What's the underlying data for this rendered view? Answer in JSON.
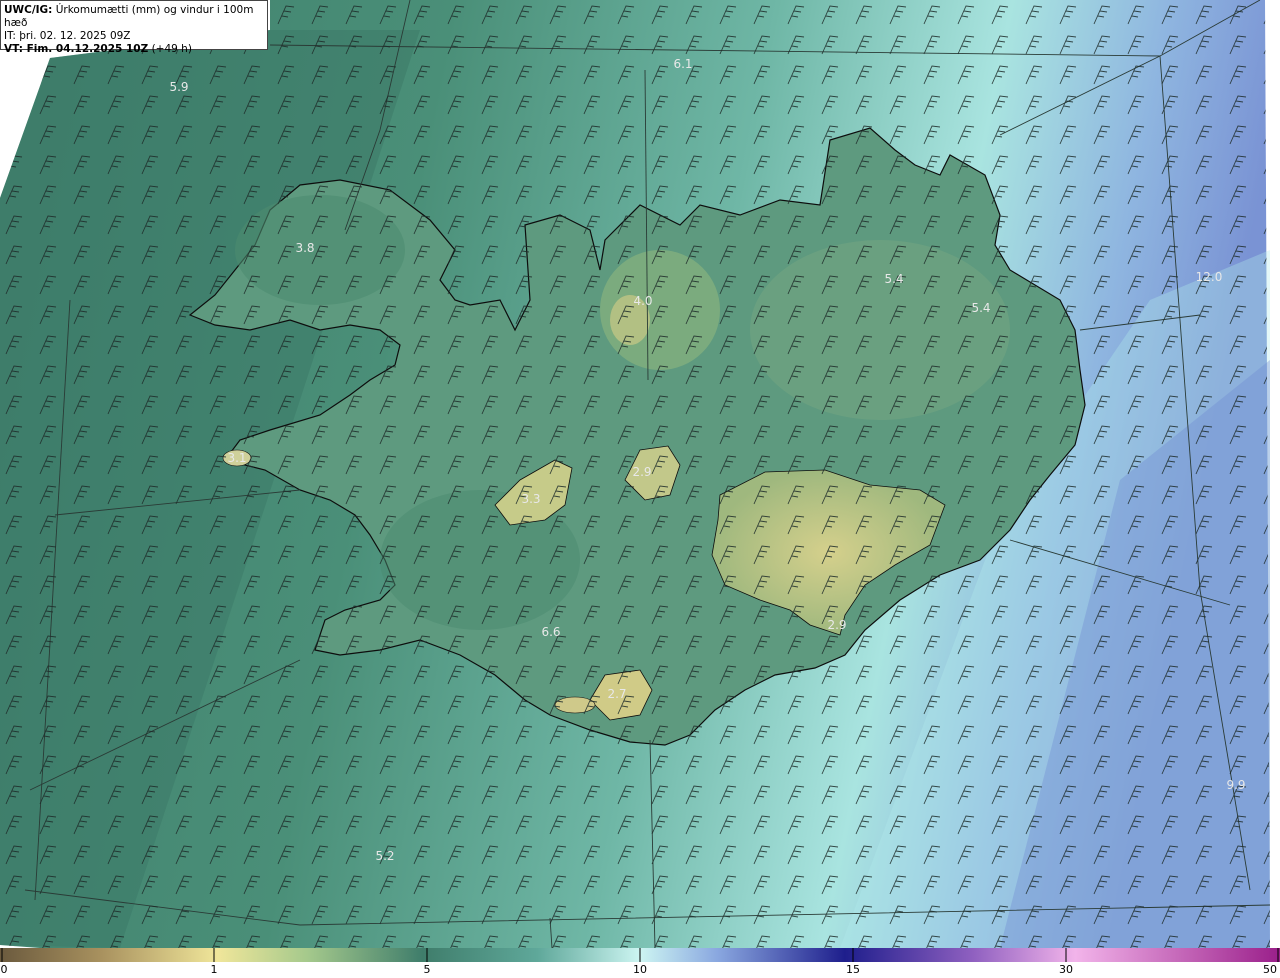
{
  "header": {
    "line1_bold": "UWC/IG:",
    "line1_rest": " Úrkomumætti (mm) og vindur i 100m hæð",
    "line2": "IT: þri. 02. 12. 2025 09Z",
    "line3_bold": "VT: Fim. 04.12.2025 10Z",
    "line3_rest": " (+49 h)"
  },
  "colorbar": {
    "ticks": [
      "0",
      "1",
      "5",
      "10",
      "15",
      "30",
      "50"
    ],
    "colors": [
      "#6b5a3e",
      "#b6a66c",
      "#f1e89a",
      "#9fc38c",
      "#4f8f6f",
      "#3e7f70",
      "#7fd0c8",
      "#c8f4f2",
      "#6f8bd0",
      "#20208f",
      "#8f5fc0",
      "#f0a8e8",
      "#a0208f"
    ]
  },
  "value_labels": [
    {
      "text": "5.9"
    },
    {
      "text": "6.1"
    },
    {
      "text": "3.8"
    },
    {
      "text": "4.0"
    },
    {
      "text": "5.4"
    },
    {
      "text": "5.4"
    },
    {
      "text": "12.0"
    },
    {
      "text": "3.1"
    },
    {
      "text": "3.3"
    },
    {
      "text": "2.9"
    },
    {
      "text": "6.6"
    },
    {
      "text": "2.9"
    },
    {
      "text": "2.7"
    },
    {
      "text": "5.2"
    },
    {
      "text": "9.9"
    }
  ]
}
